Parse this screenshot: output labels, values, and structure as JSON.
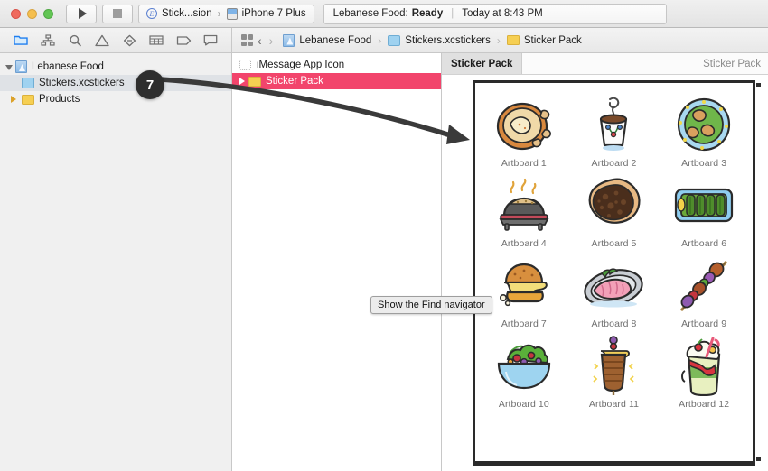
{
  "window": {
    "traffic_lights": [
      "close",
      "minimize",
      "zoom"
    ],
    "run_button": "run",
    "stop_button": "stop",
    "scheme": {
      "target": "Stick...sion",
      "destination": "iPhone 7 Plus"
    },
    "status": {
      "project": "Lebanese Food:",
      "state": "Ready",
      "separator": "|",
      "time": "Today at 8:43 PM"
    }
  },
  "navigator": {
    "toolbar_icons": [
      "folder-icon",
      "hierarchy-icon",
      "search-icon",
      "warning-icon",
      "debug-icon",
      "breakpoint-icon",
      "tag-icon",
      "report-icon"
    ],
    "active_icon": "folder-icon",
    "tree": [
      {
        "label": "Lebanese Food",
        "icon": "project-icon",
        "disclosure": "down",
        "indent": 0,
        "selected": false
      },
      {
        "label": "Stickers.xcstickers",
        "icon": "assets-icon",
        "disclosure": "none",
        "indent": 1,
        "selected": true
      },
      {
        "label": "Products",
        "icon": "folder-icon",
        "disclosure": "right",
        "indent": 1,
        "selected": false
      }
    ]
  },
  "mid_pane": {
    "grid_icon": "grid-icon",
    "back_label": "‹",
    "forward_label": "›",
    "items": [
      {
        "label": "iMessage App Icon",
        "icon": "placeholder-icon",
        "selected": false
      },
      {
        "label": "Sticker Pack",
        "icon": "folder-icon",
        "selected": true
      }
    ]
  },
  "breadcrumb": {
    "grid_icon": "grid-icon",
    "back": "‹",
    "forward": "›",
    "items": [
      {
        "label": "Lebanese Food",
        "icon": "project-icon"
      },
      {
        "label": "Stickers.xcstickers",
        "icon": "assets-icon"
      },
      {
        "label": "Sticker Pack",
        "icon": "folder-icon"
      }
    ],
    "separator": "›"
  },
  "editor": {
    "tab_label": "Sticker Pack",
    "right_label": "Sticker Pack",
    "stickers": [
      {
        "label": "Artboard 1",
        "art": "hummus-plate"
      },
      {
        "label": "Artboard 2",
        "art": "coffee-cup"
      },
      {
        "label": "Artboard 3",
        "art": "fatayer-platter"
      },
      {
        "label": "Artboard 4",
        "art": "saj-oven"
      },
      {
        "label": "Artboard 5",
        "art": "manakish-bread"
      },
      {
        "label": "Artboard 6",
        "art": "stuffed-grape-leaves"
      },
      {
        "label": "Artboard 7",
        "art": "falafel-sandwich"
      },
      {
        "label": "Artboard 8",
        "art": "fish-plate"
      },
      {
        "label": "Artboard 9",
        "art": "kebab-skewer"
      },
      {
        "label": "Artboard 10",
        "art": "fattoush-salad"
      },
      {
        "label": "Artboard 11",
        "art": "shawarma-spit"
      },
      {
        "label": "Artboard 12",
        "art": "dessert-cup"
      }
    ]
  },
  "annotations": {
    "step_badge": "7",
    "tooltip": "Show the Find navigator"
  },
  "colors": {
    "selection_pink": "#f2456c",
    "navigator_selection": "#dfe2e6",
    "badge_bg": "#2e2e2e",
    "frame_border": "#2a2a2a"
  }
}
